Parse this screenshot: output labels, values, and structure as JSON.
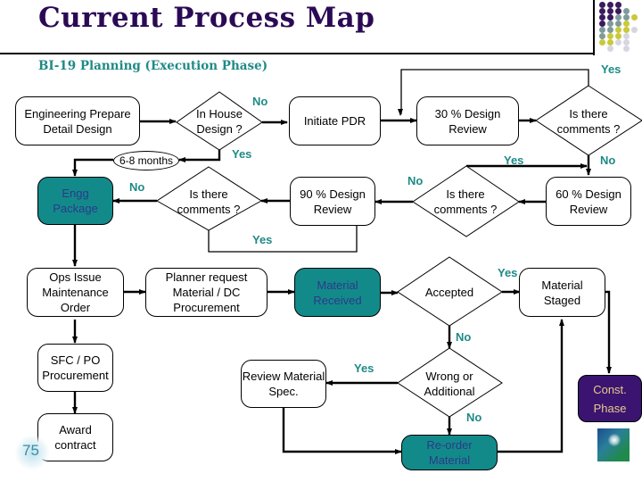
{
  "header": {
    "title": "Current Process Map",
    "subtitle": "BI-19 Planning (Execution Phase)"
  },
  "nodes": {
    "engineering_prepare": "Engineering Prepare Detail Design",
    "in_house_design": "In House Design ?",
    "initiate_pdr": "Initiate PDR",
    "design_review_30": "30 % Design Review",
    "comments_30": "Is there comments ?",
    "duration": "6-8 months",
    "engg_package": "Engg Package",
    "comments_90": "Is there comments ?",
    "design_review_90": "90 % Design Review",
    "comments_60": "Is there comments ?",
    "design_review_60": "60 % Design Review",
    "ops_issue": "Ops Issue Maintenance Order",
    "planner_request": "Planner request Material / DC Procurement",
    "material_received": "Material Received",
    "accepted": "Accepted",
    "material_staged": "Material Staged",
    "sfc_po": "SFC / PO Procurement",
    "review_spec": "Review Material Spec.",
    "wrong_or_additional": "Wrong or Additional",
    "const_phase": "Const. Phase",
    "award_contract": "Award contract",
    "reorder_material": "Re-order Material"
  },
  "labels": {
    "yes": "Yes",
    "no": "No"
  },
  "logos": {
    "left": "75",
    "right": "aramco-logo"
  },
  "colors": {
    "title": "#2b0a55",
    "subtitle": "#1f8a86",
    "teal_box": "#138a8a",
    "purple_box": "#3a1470"
  }
}
